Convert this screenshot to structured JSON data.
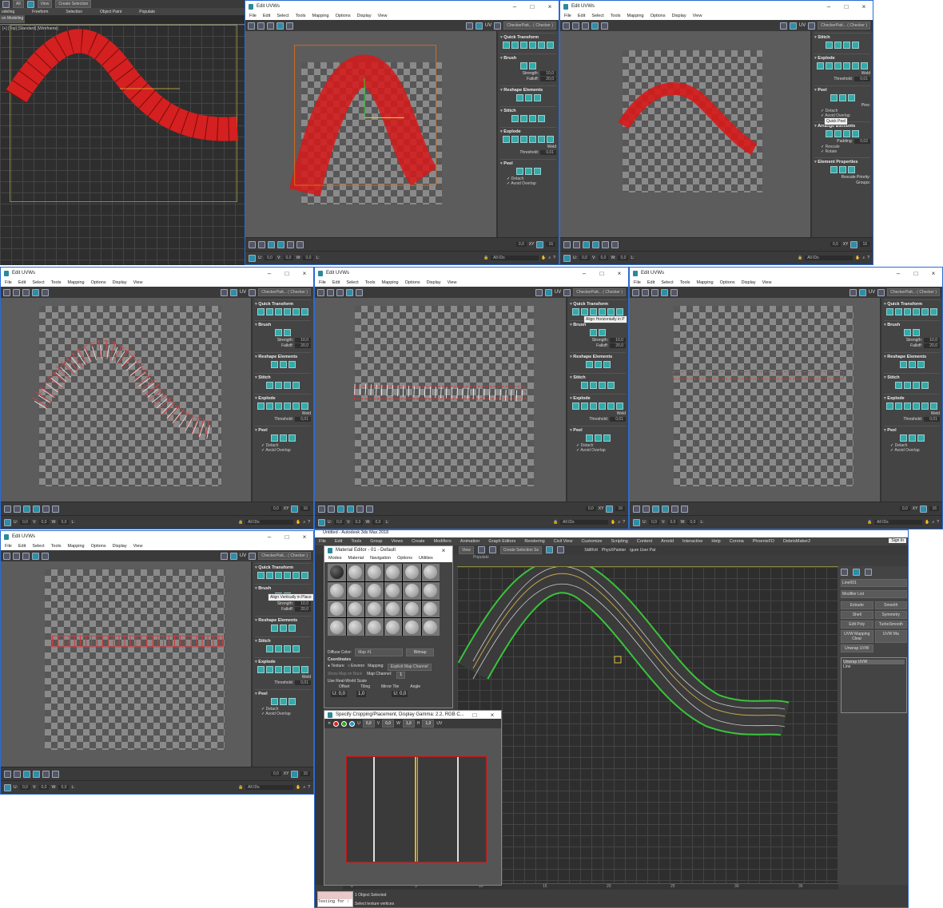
{
  "uvw_common": {
    "title": "Edit UVWs",
    "menu": [
      "File",
      "Edit",
      "Select",
      "Tools",
      "Mapping",
      "Options",
      "Display",
      "View"
    ],
    "uv_label": "UV",
    "checker_dropdown": "CheckerPatt... ( Checker )",
    "status": {
      "u_label": "U:",
      "u": "0,0",
      "v_label": "V:",
      "v": "0,0",
      "w_label": "W:",
      "w": "0,0",
      "l_label": "L:",
      "ids": "All IDs",
      "xy": "XY",
      "angle": "0,0",
      "spin": "16"
    }
  },
  "panels": {
    "standard": [
      {
        "title": "Quick Transform",
        "icons": 6
      },
      {
        "title": "Brush",
        "icons": 2,
        "fields": [
          {
            "label": "Strength:",
            "value": "10,0"
          },
          {
            "label": "Falloff:",
            "value": "20,0"
          }
        ]
      },
      {
        "title": "Reshape Elements",
        "icons": 3
      },
      {
        "title": "Stitch",
        "icons": 4
      },
      {
        "title": "Explode",
        "icons": 6,
        "fields": [
          {
            "label": "Weld",
            "value": ""
          },
          {
            "label": "Threshold:",
            "value": "0,01"
          }
        ]
      },
      {
        "title": "Peel",
        "icons": 3,
        "checks": [
          "Detach",
          "Avoid Overlap"
        ]
      }
    ],
    "peel": [
      {
        "title": "Stitch",
        "icons": 4
      },
      {
        "title": "Explode",
        "icons": 6,
        "fields": [
          {
            "label": "Weld",
            "value": ""
          },
          {
            "label": "Threshold:",
            "value": "0,01"
          }
        ]
      },
      {
        "title": "Peel",
        "icons": 3,
        "checks": [
          "Detach",
          "Avoid Overlap"
        ],
        "fields": [
          {
            "label": "Pins:",
            "value": ""
          }
        ]
      },
      {
        "title": "Arrange Elements",
        "icons": 4,
        "checks": [
          "Rescale",
          "Rotate"
        ],
        "fields": [
          {
            "label": "Padding:",
            "value": "0,02"
          }
        ]
      },
      {
        "title": "Element Properties",
        "icons": 3,
        "fields": [
          {
            "label": "Rescale Priority:",
            "value": ""
          },
          {
            "label": "Groups:",
            "value": ""
          }
        ]
      }
    ],
    "short": [
      {
        "title": "Quick Transform",
        "icons": 6
      },
      {
        "title": "Brush",
        "icons": 2,
        "fields": [
          {
            "label": "Strength:",
            "value": "10,0"
          },
          {
            "label": "Falloff:",
            "value": "20,0"
          }
        ]
      },
      {
        "title": "Reshape Elements",
        "icons": 3
      },
      {
        "title": "Stitch",
        "icons": 4
      },
      {
        "title": "Explode",
        "icons": 6
      }
    ]
  },
  "tooltips": {
    "quick_peel": "Quick Peel",
    "align_h": "Align Horizontally in P",
    "align_v": "Align Vertically in Place"
  },
  "topleft": {
    "toolbar_select": "All",
    "view_dropdown": "View",
    "create_sel": "Create Selection",
    "ribbon_tabs": [
      "odeling",
      "Freeform",
      "Selection",
      "Object Paint",
      "Populate"
    ],
    "sub_label": "on Modeling",
    "viewport_label": "[+] [Top] [Standard] [Wireframe]"
  },
  "max": {
    "title": "Untitled - Autodesk 3ds Max 2018",
    "menu": [
      "File",
      "Edit",
      "Tools",
      "Group",
      "Views",
      "Create",
      "Modifiers",
      "Animation",
      "Graph Editors",
      "Rendering",
      "Civil View",
      "Customize",
      "Scripting",
      "Content",
      "Arnold",
      "Interactive",
      "Help",
      "Corona",
      "PhoenixFD",
      "DebrisMaker2"
    ],
    "sign_in": "Sign In",
    "view_dropdown": "View",
    "create_sel": "Create Selection Se",
    "plugins": [
      "SkillKrit",
      "PhysXPainter",
      "igure User Pat"
    ],
    "ribbon": "Populate",
    "object_name": "Line001",
    "modifier_list": "Modifier List",
    "modifier_buttons": [
      "Extrude",
      "Smooth",
      "Shell",
      "Symmetry",
      "Edit Poly",
      "TurboSmooth",
      "UVW Mapping Clear",
      "UVW Ma",
      "Unwrap UVW"
    ],
    "stack": [
      "Unwrap UVW",
      "Line"
    ],
    "timeline_ticks": [
      "0",
      "5",
      "10",
      "15",
      "20",
      "25",
      "30",
      "35"
    ],
    "status_selected": "1 Object Selected",
    "status_prompt": "Select texture vertices",
    "maxscript": "Testing for :"
  },
  "mat_editor": {
    "title": "Material Editor - 01 - Default",
    "menu": [
      "Modes",
      "Material",
      "Navigation",
      "Options",
      "Utilities"
    ],
    "diffuse_label": "Diffuse Color:",
    "map_name": "Map #1",
    "map_type": "Bitmap",
    "coords_title": "Coordinates",
    "texture": "Texture",
    "environ": "Environ",
    "mapping_label": "Mapping:",
    "mapping_value": "Explicit Map Channel",
    "show_map": "Show Map on Back",
    "map_channel_label": "Map Channel:",
    "map_channel": "1",
    "real_world": "Use Real-World Scale",
    "cols": [
      "Offset",
      "Tiling",
      "Mirror Tile",
      "Angle"
    ],
    "u_row": [
      "U: 0,0",
      "1,0",
      "U: 0,0"
    ]
  },
  "crop": {
    "title": "Specify Cropping/Placement, Display Gamma: 2.2, RGB C...",
    "u_label": "U",
    "u": "0,0",
    "v_label": "V",
    "v": "0,0",
    "w_label": "W",
    "w": "1,0",
    "h_label": "H",
    "h": "1,0",
    "uv": "UV"
  }
}
